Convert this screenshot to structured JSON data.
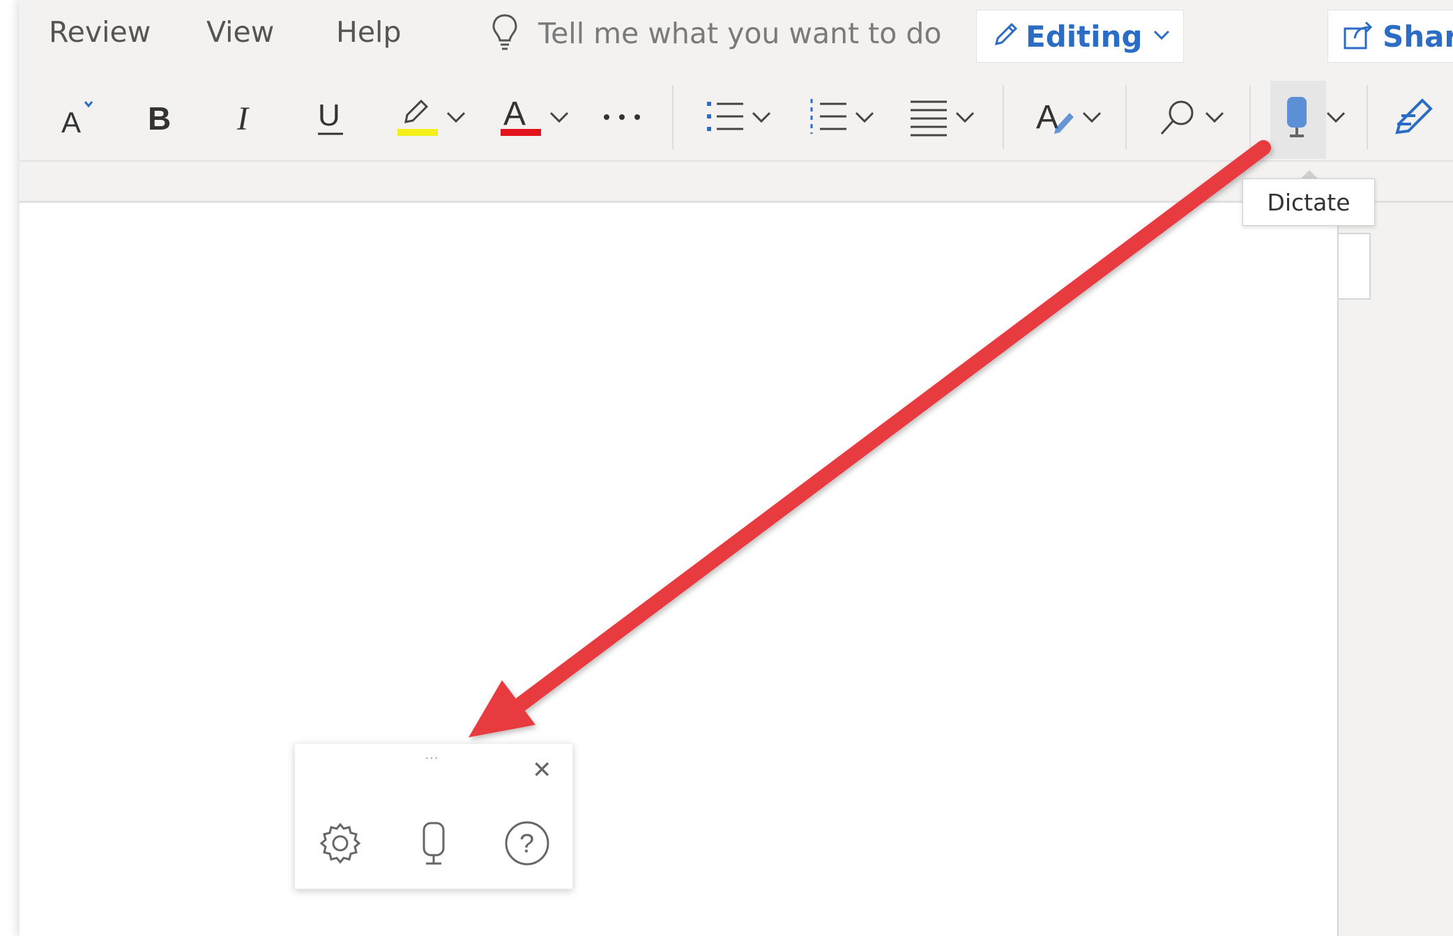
{
  "menu": {
    "tabs": [
      {
        "label": "Review"
      },
      {
        "label": "View"
      },
      {
        "label": "Help"
      }
    ],
    "tell_me": "Tell me what you want to do",
    "editing_label": "Editing",
    "share_label": "Share"
  },
  "tooltip": {
    "text": "Dictate"
  },
  "colors": {
    "accent": "#2b6cc4",
    "highlight": "#f4ef1c",
    "font_color": "#e3131b",
    "arrow": "#e83a3f"
  },
  "icons": [
    "font-size-icon",
    "bold-icon",
    "italic-icon",
    "underline-icon",
    "highlight-icon",
    "font-color-icon",
    "more-icon",
    "bullets-icon",
    "numbering-icon",
    "align-icon",
    "styles-icon",
    "find-icon",
    "dictate-icon",
    "editor-icon",
    "settings-icon",
    "microphone-icon",
    "help-icon",
    "close-icon"
  ]
}
